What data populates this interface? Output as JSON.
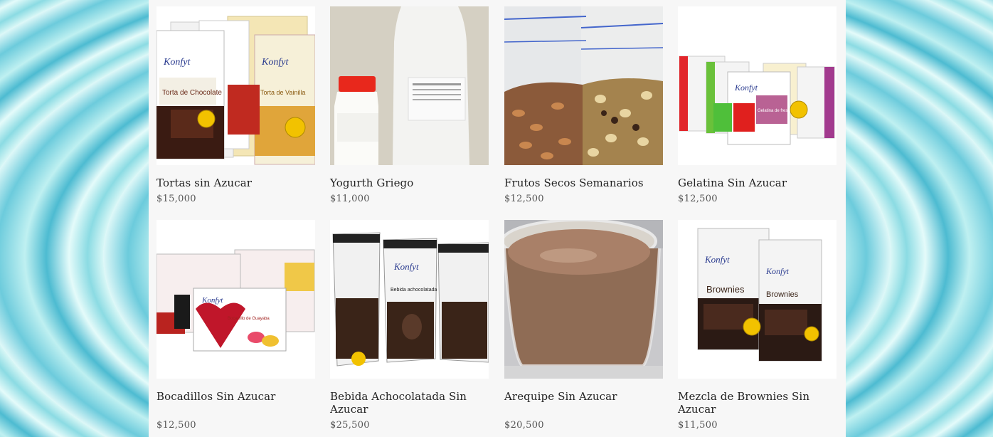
{
  "products": [
    {
      "name": "Tortas sin Azucar",
      "price": "$15,000",
      "image": "cake-mix-boxes",
      "brand": "Konfyt",
      "box_text": [
        "Torta de Chocolate",
        "Torta de Vainilla"
      ]
    },
    {
      "name": "Yogurth Griego",
      "price": "$11,000",
      "image": "yogurt-bottles"
    },
    {
      "name": "Frutos Secos Semanarios",
      "price": "$12,500",
      "image": "nut-bags"
    },
    {
      "name": "Gelatina Sin Azucar",
      "price": "$12,500",
      "image": "gelatin-boxes",
      "brand": "Konfyt",
      "box_text": [
        "Gelatina de fresa"
      ]
    },
    {
      "name": "Bocadillos Sin Azucar",
      "price": "$12,500",
      "image": "bocadillo-boxes",
      "brand": "Konfyt",
      "box_text": [
        "Bocadillo de Guayaba"
      ]
    },
    {
      "name": "Bebida Achocolatada Sin Azucar",
      "price": "$25,500",
      "image": "chocolate-drink-pouches",
      "brand": "Konfyt",
      "box_text": [
        "Bebida achocolatada"
      ]
    },
    {
      "name": "Arequipe Sin Azucar",
      "price": "$20,500",
      "image": "arequipe-jar"
    },
    {
      "name": "Mezcla de Brownies Sin Azucar",
      "price": "$11,500",
      "image": "brownie-mix-boxes",
      "brand": "Konfyt",
      "box_text": [
        "Brownies"
      ]
    }
  ]
}
